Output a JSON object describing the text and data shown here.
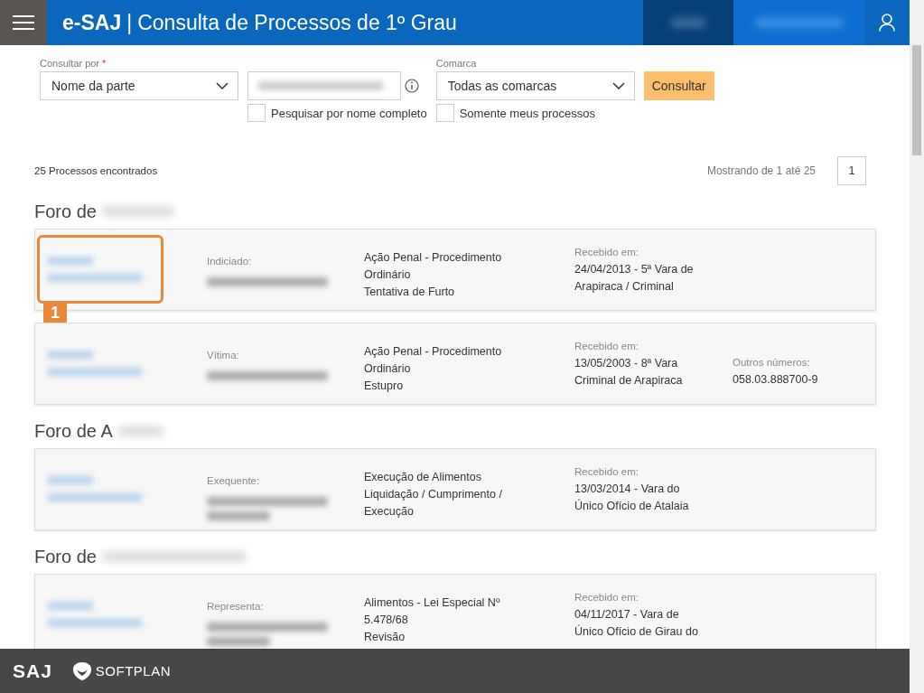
{
  "header": {
    "brand": "e-SAJ",
    "separator": "|",
    "title": "Consulta de Processos de 1º Grau"
  },
  "search": {
    "consultar_por": {
      "label": "Consultar por",
      "required_mark": "*",
      "value": "Nome da parte"
    },
    "full_name_checkbox": {
      "label": "Pesquisar por nome completo",
      "checked": false
    },
    "comarca": {
      "label": "Comarca",
      "value": "Todas as comarcas"
    },
    "my_processes_checkbox": {
      "label": "Somente meus processos",
      "checked": false
    },
    "button": "Consultar"
  },
  "results": {
    "count": "25 Processos encontrados",
    "showing": "Mostrando de 1 até 25",
    "pages": [
      {
        "label": "1",
        "selected": true
      }
    ]
  },
  "groups": [
    {
      "heading": "Foro de",
      "cards": [
        {
          "annotation": "1",
          "party_label": "Indiciado:",
          "kind": "single",
          "class_lines": [
            "Ação Penal - Procedimento",
            "Ordinário",
            "Tentativa de Furto"
          ],
          "received_label": "Recebido em:",
          "received_lines": [
            "24/04/2013 - 5ª Vara de",
            "Arapiraca / Criminal"
          ]
        },
        {
          "party_label": "Vítima:",
          "kind": "single",
          "class_lines": [
            "Ação Penal - Procedimento",
            "Ordinário",
            "Estupro"
          ],
          "received_label": "Recebido em:",
          "received_lines": [
            "13/05/2003 - 8ª Vara",
            "Criminal de Arapiraca"
          ],
          "other_label": "Outros números:",
          "other": "058.03.888700-9"
        }
      ]
    },
    {
      "heading": "Foro de A",
      "cards": [
        {
          "party_label": "Exequente:",
          "kind": "double",
          "class_lines": [
            "Execução de Alimentos",
            "Liquidação / Cumprimento /",
            "Execução"
          ],
          "received_label": "Recebido em:",
          "received_lines": [
            "13/03/2014 - Vara do",
            "Único Ofício de Atalaia"
          ]
        }
      ]
    },
    {
      "heading": "Foro de",
      "cards": [
        {
          "party_label": "Representa:",
          "kind": "double",
          "class_lines": [
            "Alimentos - Lei Especial Nº",
            "5.478/68",
            "Revisão"
          ],
          "received_label": "Recebido em:",
          "received_lines": [
            "04/11/2017 - Vara de",
            "Único Ofício de Girau do"
          ]
        }
      ]
    }
  ],
  "footer": {
    "saj_logo": "SAJ",
    "softplan_logo": "SOFTPLAN"
  }
}
